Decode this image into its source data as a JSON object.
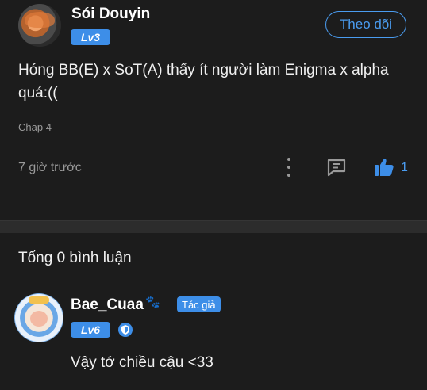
{
  "post": {
    "username": "Sói Douyin",
    "level": "Lv3",
    "follow_label": "Theo dõi",
    "content": "Hóng BB(E) x SoT(A) thấy ít người làm Enigma x alpha quá:((",
    "chapter": "Chap 4",
    "time": "7 giờ trước",
    "like_count": "1"
  },
  "comments": {
    "total_label": "Tổng 0 bình luận"
  },
  "reply": {
    "username": "Bae_Cuaa",
    "badge": "Tác giả",
    "level": "Lv6",
    "text": "Vậy tớ chiều cậu <33"
  },
  "colors": {
    "accent": "#3d8ee8",
    "background": "#1c1c1c",
    "muted": "#9a9a9a"
  },
  "icons": [
    "more-vertical-icon",
    "comment-icon",
    "thumbs-up-icon",
    "shield-icon",
    "paw-icon"
  ]
}
